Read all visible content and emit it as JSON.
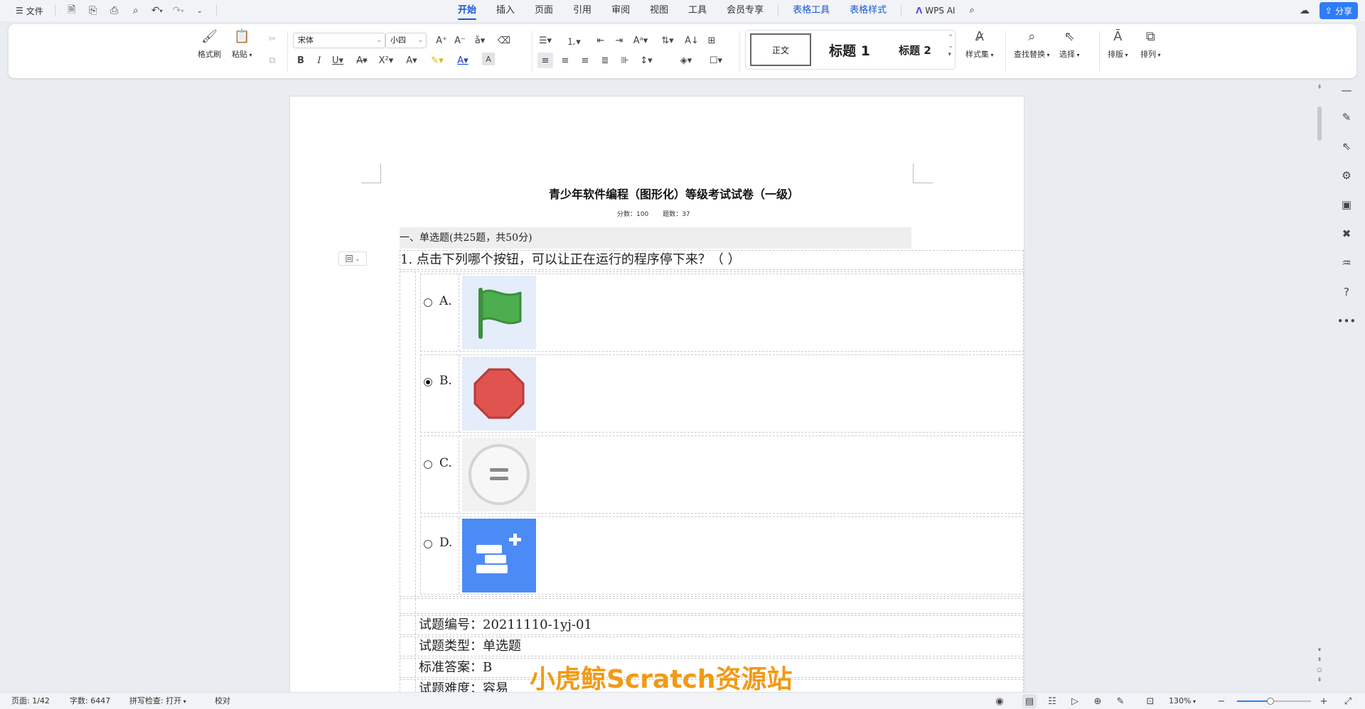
{
  "menubar": {
    "file_label": "文件",
    "tabs": [
      {
        "label": "开始",
        "active": true
      },
      {
        "label": "插入"
      },
      {
        "label": "页面"
      },
      {
        "label": "引用"
      },
      {
        "label": "审阅"
      },
      {
        "label": "视图"
      },
      {
        "label": "工具"
      },
      {
        "label": "会员专享"
      }
    ],
    "context_tabs": [
      {
        "label": "表格工具"
      },
      {
        "label": "表格样式"
      }
    ],
    "wps_ai_label": "WPS AI",
    "share_label": "分享"
  },
  "ribbon": {
    "format_painter_label": "格式刷",
    "paste_label": "粘贴",
    "font_name": "宋体",
    "font_size": "小四",
    "styles": {
      "normal": "正文",
      "heading1": "标题 1",
      "heading2": "标题 2"
    },
    "style_set_label": "样式集",
    "find_replace_label": "查找替换",
    "select_label": "选择",
    "layout_label": "排版",
    "arrange_label": "排列"
  },
  "document": {
    "title": "青少年软件编程（图形化）等级考试试卷（一级）",
    "score_text": "分数：100",
    "count_text": "题数：37",
    "section_heading": "一、单选题(共25题，共50分)",
    "question": "1. 点击下列哪个按钮，可以让正在运行的程序停下来？（ ）",
    "options": [
      {
        "letter": "A.",
        "icon": "green-flag-icon",
        "checked": false
      },
      {
        "letter": "B.",
        "icon": "red-stop-octagon-icon",
        "checked": true
      },
      {
        "letter": "C.",
        "icon": "equals-circle-icon",
        "checked": false
      },
      {
        "letter": "D.",
        "icon": "add-extension-blocks-icon",
        "checked": false
      }
    ],
    "meta": [
      {
        "text": "试题编号：20211110-1yj-01"
      },
      {
        "text": "试题类型：单选题"
      },
      {
        "text": "标准答案：B"
      },
      {
        "text": "试题难度：容易"
      }
    ],
    "watermark": "小虎鲸Scratch资源站"
  },
  "statusbar": {
    "page": "页面: 1/42",
    "words": "字数: 6447",
    "spellcheck": "拼写检查: 打开",
    "proofread": "校对",
    "zoom": "130%",
    "zoom_fraction": 0.45
  },
  "colors": {
    "accent": "#1a57d6",
    "share": "#2f7cf6",
    "flag_green": "#4cae4c",
    "stop_red": "#e0534f",
    "extension_blue": "#4c8bf5",
    "watermark_orange": "#f19a16"
  }
}
